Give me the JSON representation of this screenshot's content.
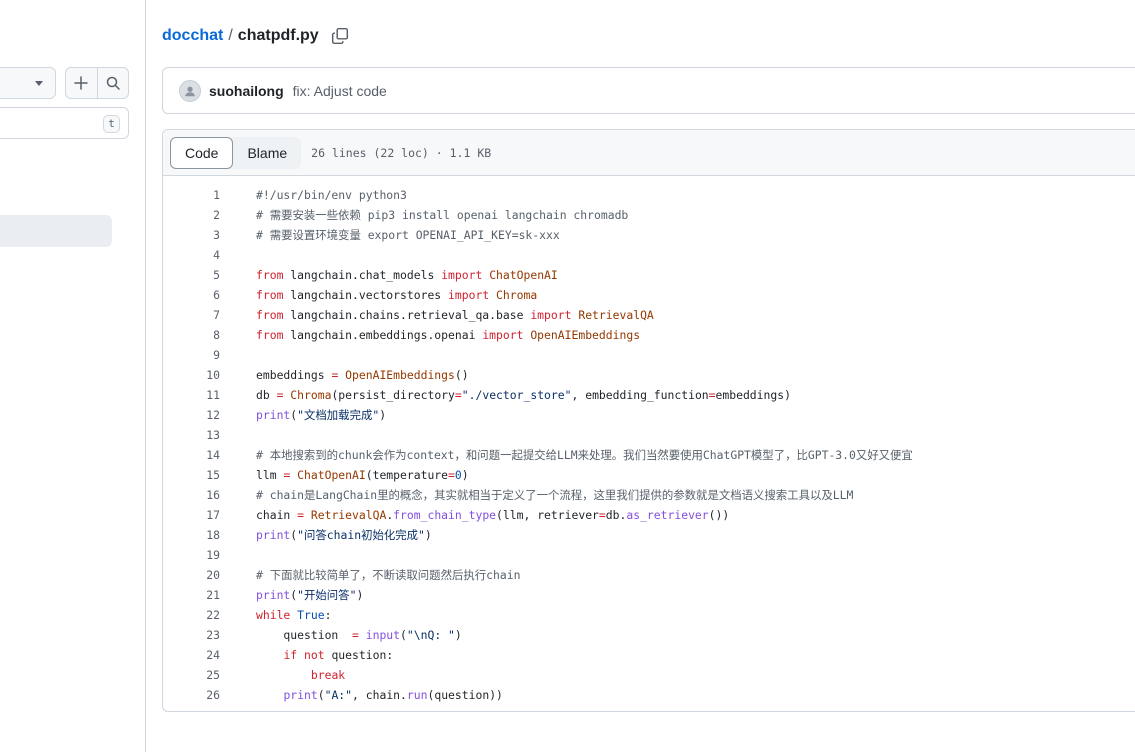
{
  "sidebar": {
    "goto_file_shortcut": "t"
  },
  "breadcrumb": {
    "repo": "docchat",
    "separator": "/",
    "file": "chatpdf.py"
  },
  "commit": {
    "author": "suohailong",
    "message": "fix: Adjust code"
  },
  "file_header": {
    "tabs": [
      {
        "label": "Code",
        "active": true
      },
      {
        "label": "Blame",
        "active": false
      }
    ],
    "meta": "26 lines (22 loc) · 1.1 KB"
  },
  "colors": {
    "link": "#0969da",
    "keyword": "#cf222e",
    "class_name": "#953800",
    "string": "#0a3069",
    "comment": "#57606a",
    "number": "#0550ae",
    "method": "#8250df"
  },
  "code_lines": [
    {
      "n": "1",
      "text": "#!/usr/bin/env python3"
    },
    {
      "n": "2",
      "text": "# 需要安装一些依赖 pip3 install openai langchain chromadb"
    },
    {
      "n": "3",
      "text": "# 需要设置环境变量 export OPENAI_API_KEY=sk-xxx"
    },
    {
      "n": "4",
      "text": ""
    },
    {
      "n": "5",
      "text": "from langchain.chat_models import ChatOpenAI"
    },
    {
      "n": "6",
      "text": "from langchain.vectorstores import Chroma"
    },
    {
      "n": "7",
      "text": "from langchain.chains.retrieval_qa.base import RetrievalQA"
    },
    {
      "n": "8",
      "text": "from langchain.embeddings.openai import OpenAIEmbeddings"
    },
    {
      "n": "9",
      "text": ""
    },
    {
      "n": "10",
      "text": "embeddings = OpenAIEmbeddings()"
    },
    {
      "n": "11",
      "text": "db = Chroma(persist_directory=\"./vector_store\", embedding_function=embeddings)"
    },
    {
      "n": "12",
      "text": "print(\"文档加载完成\")"
    },
    {
      "n": "13",
      "text": ""
    },
    {
      "n": "14",
      "text": "# 本地搜索到的chunk会作为context，和问题一起提交给LLM来处理。我们当然要使用ChatGPT模型了，比GPT-3.0又好又便宜"
    },
    {
      "n": "15",
      "text": "llm = ChatOpenAI(temperature=0)"
    },
    {
      "n": "16",
      "text": "# chain是LangChain里的概念，其实就相当于定义了一个流程，这里我们提供的参数就是文档语义搜索工具以及LLM"
    },
    {
      "n": "17",
      "text": "chain = RetrievalQA.from_chain_type(llm, retriever=db.as_retriever())"
    },
    {
      "n": "18",
      "text": "print(\"问答chain初始化完成\")"
    },
    {
      "n": "19",
      "text": ""
    },
    {
      "n": "20",
      "text": "# 下面就比较简单了，不断读取问题然后执行chain"
    },
    {
      "n": "21",
      "text": "print(\"开始问答\")"
    },
    {
      "n": "22",
      "text": "while True:"
    },
    {
      "n": "23",
      "text": "    question  = input(\"\\nQ: \")"
    },
    {
      "n": "24",
      "text": "    if not question:"
    },
    {
      "n": "25",
      "text": "        break"
    },
    {
      "n": "26",
      "text": "    print(\"A:\", chain.run(question))"
    }
  ]
}
